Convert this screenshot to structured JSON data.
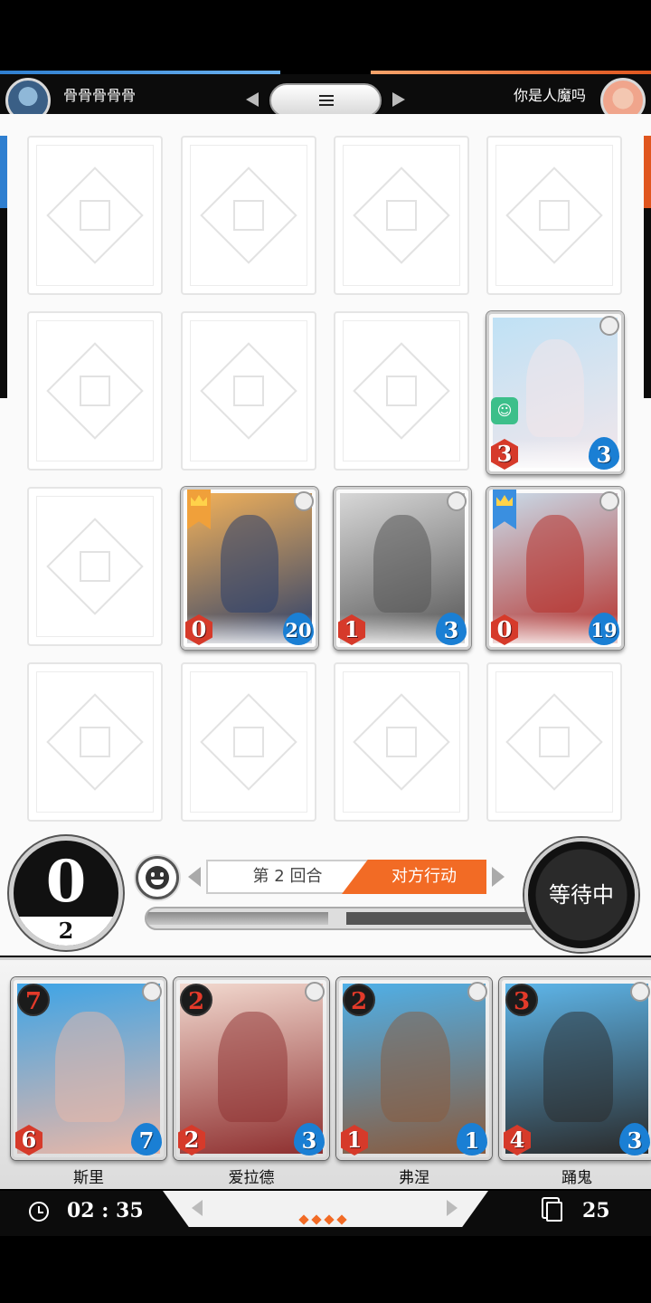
{
  "top": {
    "player_left": "骨骨骨骨骨",
    "player_right": "你是人魔吗"
  },
  "board_cards": [
    {
      "id": "card-r2c4",
      "attack": "3",
      "health": "3",
      "badge": "mask",
      "palette": [
        "#bfe1f5",
        "#f2e6ea"
      ]
    },
    {
      "id": "card-r3c2",
      "attack": "0",
      "health": "20",
      "badge": "crown-gold",
      "palette": [
        "#f3b25a",
        "#2b3f6b"
      ]
    },
    {
      "id": "card-r3c3",
      "attack": "1",
      "health": "3",
      "badge": "none",
      "palette": [
        "#d7d7d7",
        "#555555"
      ]
    },
    {
      "id": "card-r3c4",
      "attack": "0",
      "health": "19",
      "badge": "crown-blue",
      "palette": [
        "#c9dcea",
        "#b6312c"
      ]
    }
  ],
  "status": {
    "mana": "0",
    "mana_max": "2",
    "round_label": "第 2 回合",
    "action_label": "对方行动",
    "wait_label": "等待中",
    "progress": 0.46
  },
  "hand": [
    {
      "name": "斯里",
      "cost": "7",
      "attack": "6",
      "health": "7",
      "palette": [
        "#3ea4e6",
        "#e9b7a7"
      ]
    },
    {
      "name": "爱拉德",
      "cost": "2",
      "attack": "2",
      "health": "3",
      "palette": [
        "#f2d9cf",
        "#8e2f2f"
      ]
    },
    {
      "name": "弗涅",
      "cost": "2",
      "attack": "1",
      "health": "1",
      "palette": [
        "#4fb0e8",
        "#8a5a3c"
      ]
    },
    {
      "name": "踊鬼",
      "cost": "3",
      "attack": "4",
      "health": "3",
      "palette": [
        "#5eb6ea",
        "#2a2a2a"
      ]
    }
  ],
  "bottom": {
    "timer": "02 : 35",
    "deck_count": "25"
  },
  "colors": {
    "accent_orange": "#f26b25",
    "player_blue": "#2f7fd0",
    "attack_red": "#d63a2a",
    "health_blue": "#1a7fd4"
  },
  "icons": [
    "menu-icon",
    "emote-icon",
    "clock-icon",
    "deck-icon",
    "crown-icon",
    "mask-icon"
  ]
}
